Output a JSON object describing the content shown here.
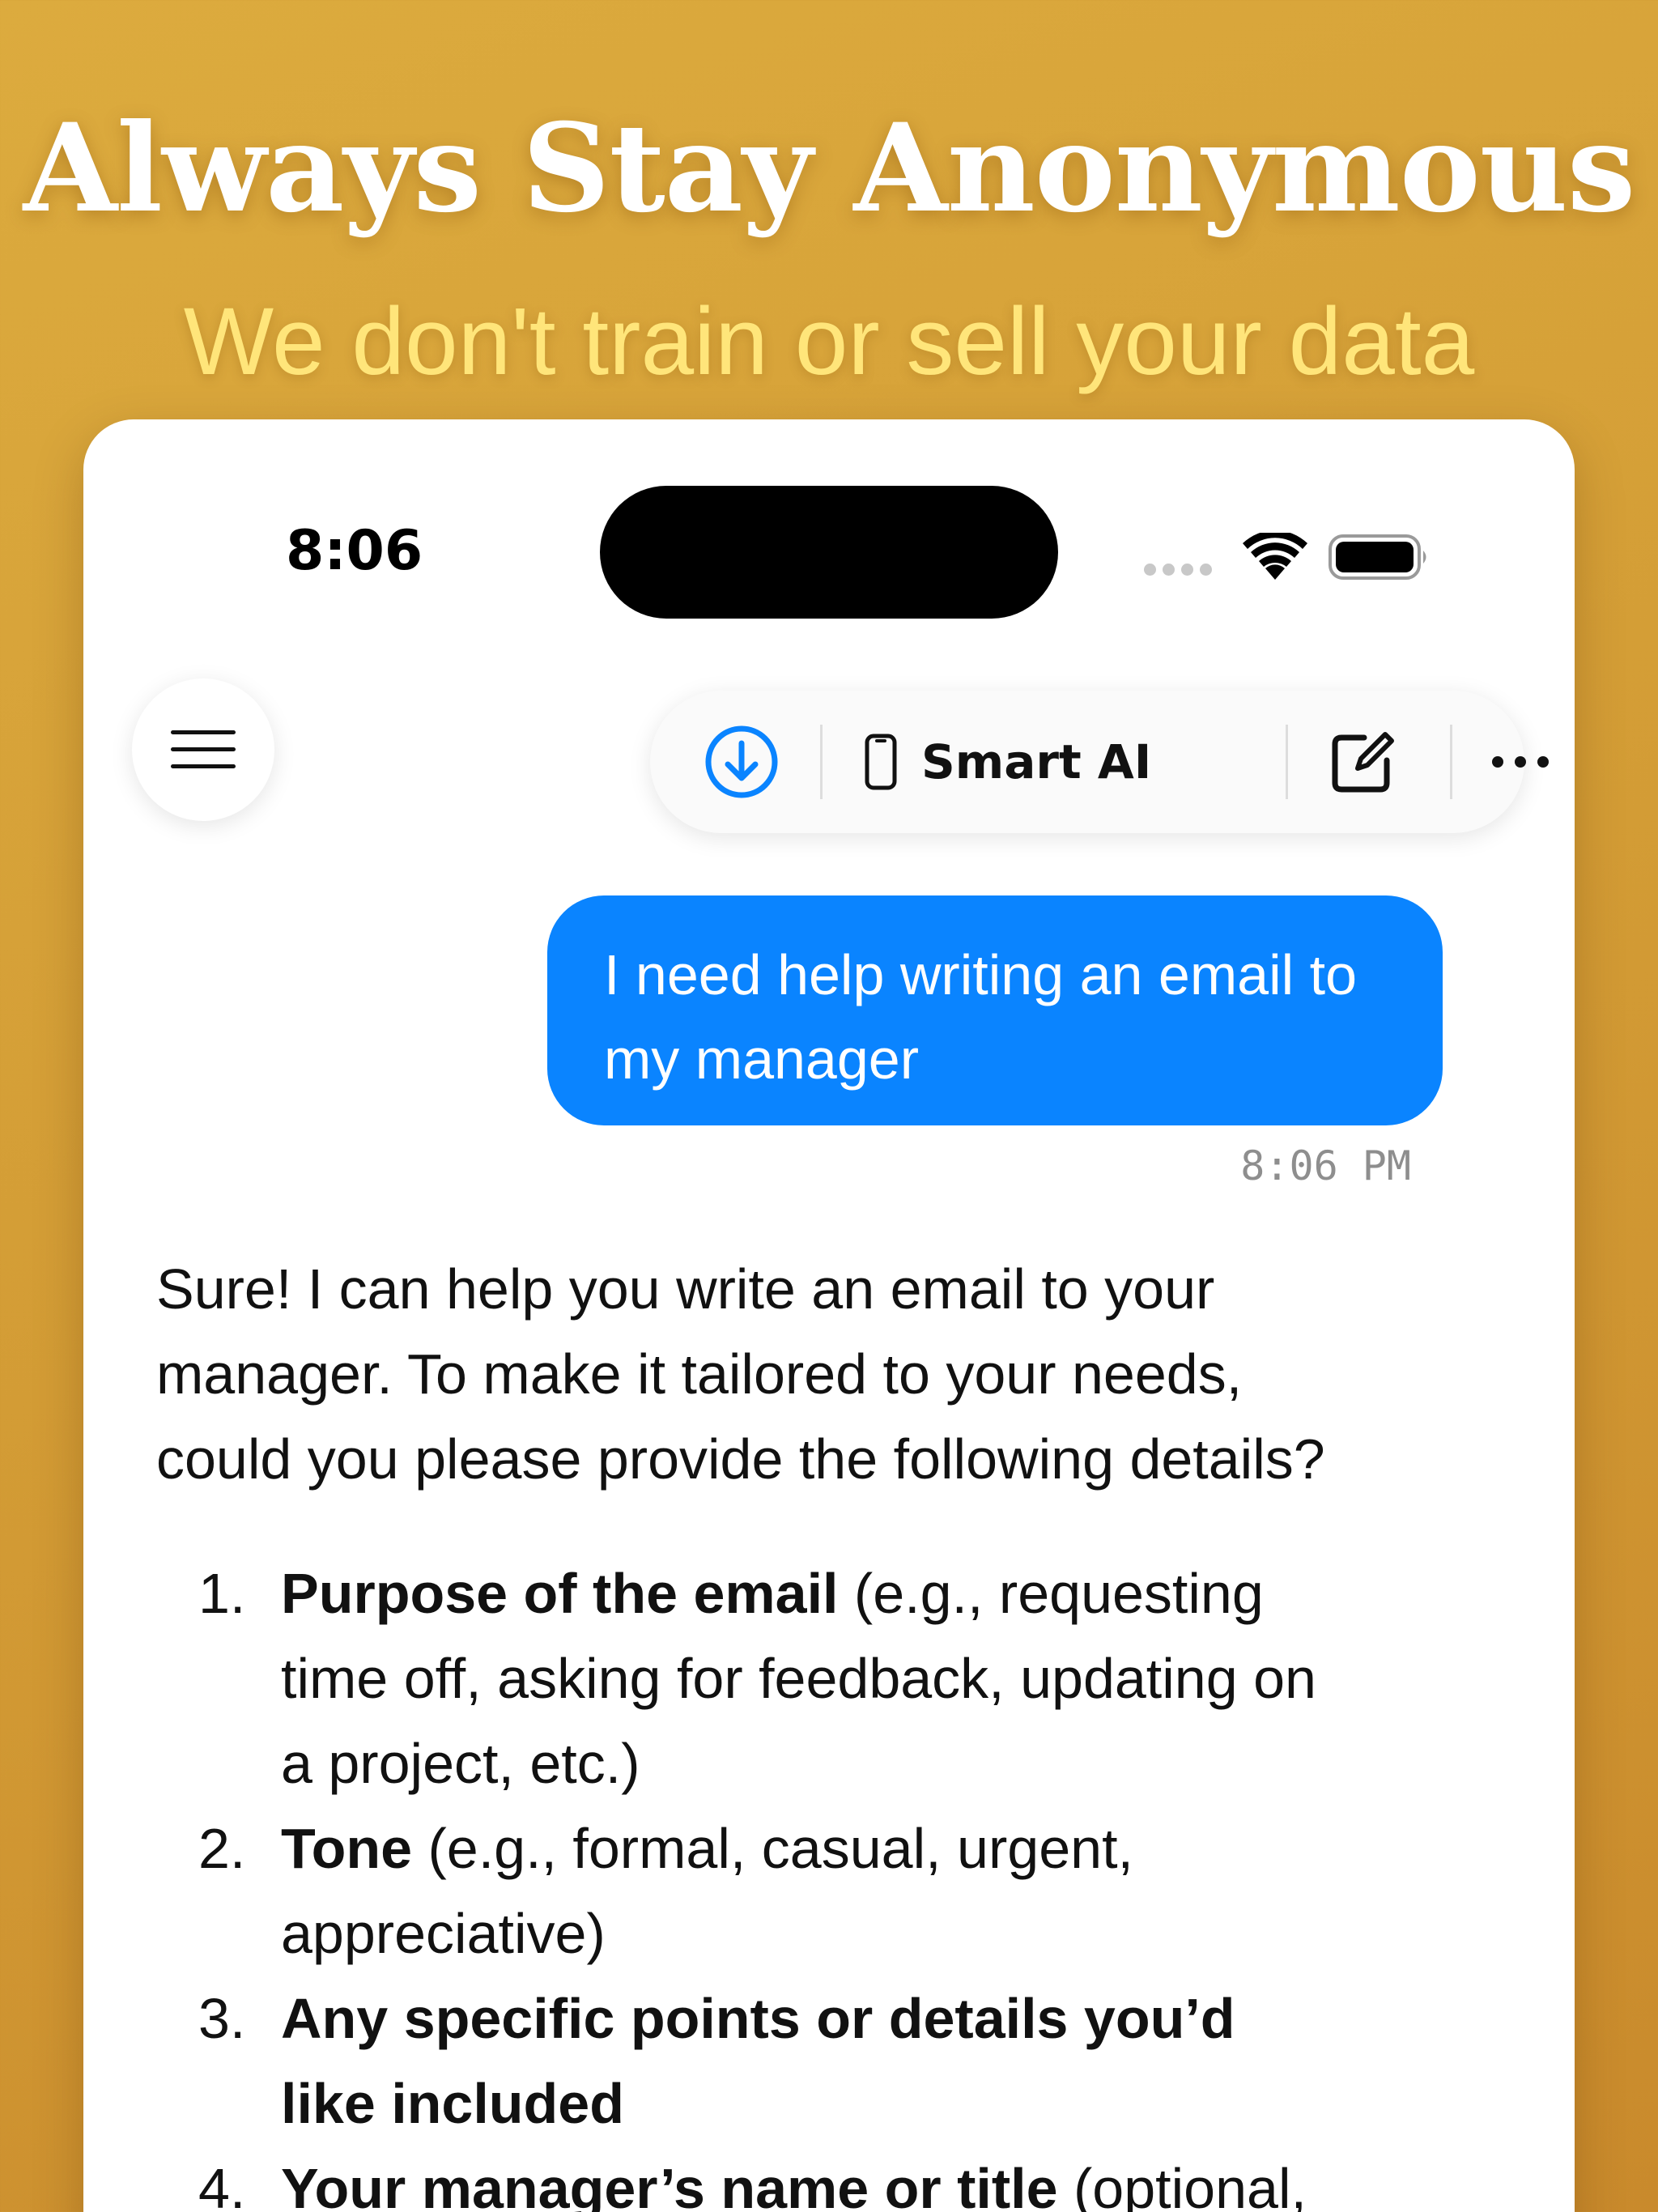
{
  "promo": {
    "headline": "Always Stay Anonymous",
    "subheadline": "We don't train or sell your data",
    "colors": {
      "background": "#d6a138",
      "headline": "#ffffff",
      "subheadline": "#ffe57a"
    }
  },
  "status_bar": {
    "time": "8:06",
    "icons": [
      "signal-dots-icon",
      "wifi-icon",
      "battery-icon"
    ]
  },
  "toolbar": {
    "menu_icon": "hamburger-menu-icon",
    "download_icon": "download-circle-icon",
    "device_icon": "phone-icon",
    "model_label": "Smart AI",
    "new_chat_icon": "compose-icon",
    "more_icon": "ellipsis-icon",
    "accent_color": "#0a84ff"
  },
  "chat": {
    "user_message": {
      "line1": "I need help writing an email to",
      "line2": "my manager",
      "timestamp": "8:06 PM",
      "bubble_color": "#0a84ff"
    },
    "assistant_message": {
      "intro_line1": "Sure! I can help you write an email to your",
      "intro_line2": "manager. To make it tailored to your needs,",
      "intro_line3": "could you please provide the following details?",
      "items": [
        {
          "number": "1.",
          "bold": "Purpose of the email",
          "rest_line1": " (e.g., requesting",
          "rest_line2": "time off, asking for feedback, updating on",
          "rest_line3": "a project, etc.)"
        },
        {
          "number": "2.",
          "bold": "Tone",
          "rest_line1": " (e.g., formal, casual, urgent,",
          "rest_line2": "appreciative)"
        },
        {
          "number": "3.",
          "bold_line1": "Any specific points or details you’d",
          "bold_line2": "like included"
        },
        {
          "number": "4.",
          "bold": "Your manager’s name or title",
          "rest_line1": " (optional,"
        }
      ]
    }
  }
}
